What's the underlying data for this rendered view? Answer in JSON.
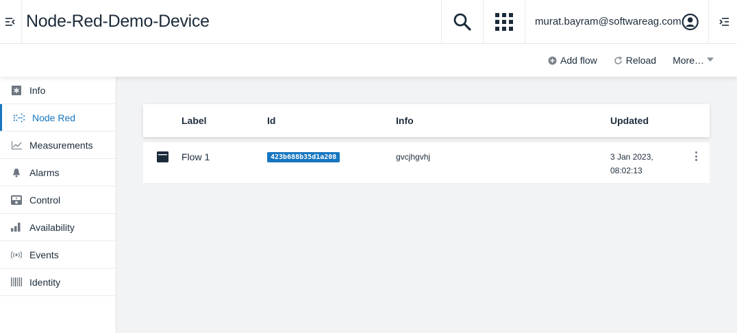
{
  "header": {
    "title": "Node-Red-Demo-Device",
    "user_email": "murat.bayram@softwareag.com"
  },
  "actions": {
    "add_flow": "Add flow",
    "reload": "Reload",
    "more": "More…"
  },
  "sidebar": {
    "items": [
      {
        "label": "Info",
        "icon": "info-icon"
      },
      {
        "label": "Node Red",
        "icon": "node-red-icon",
        "active": true
      },
      {
        "label": "Measurements",
        "icon": "line-chart-icon"
      },
      {
        "label": "Alarms",
        "icon": "bell-icon"
      },
      {
        "label": "Control",
        "icon": "control-icon"
      },
      {
        "label": "Availability",
        "icon": "bar-chart-icon"
      },
      {
        "label": "Events",
        "icon": "broadcast-icon"
      },
      {
        "label": "Identity",
        "icon": "barcode-icon"
      }
    ]
  },
  "table": {
    "columns": [
      "Label",
      "Id",
      "Info",
      "Updated"
    ],
    "rows": [
      {
        "label": "Flow 1",
        "id": "423b688b35d1a208",
        "info": "gvcjhgvhj",
        "updated_date": "3 Jan 2023,",
        "updated_time": "08:02:13"
      }
    ]
  },
  "colors": {
    "accent": "#1776bf",
    "text": "#1c2b3a",
    "background": "#f2f3f4"
  }
}
